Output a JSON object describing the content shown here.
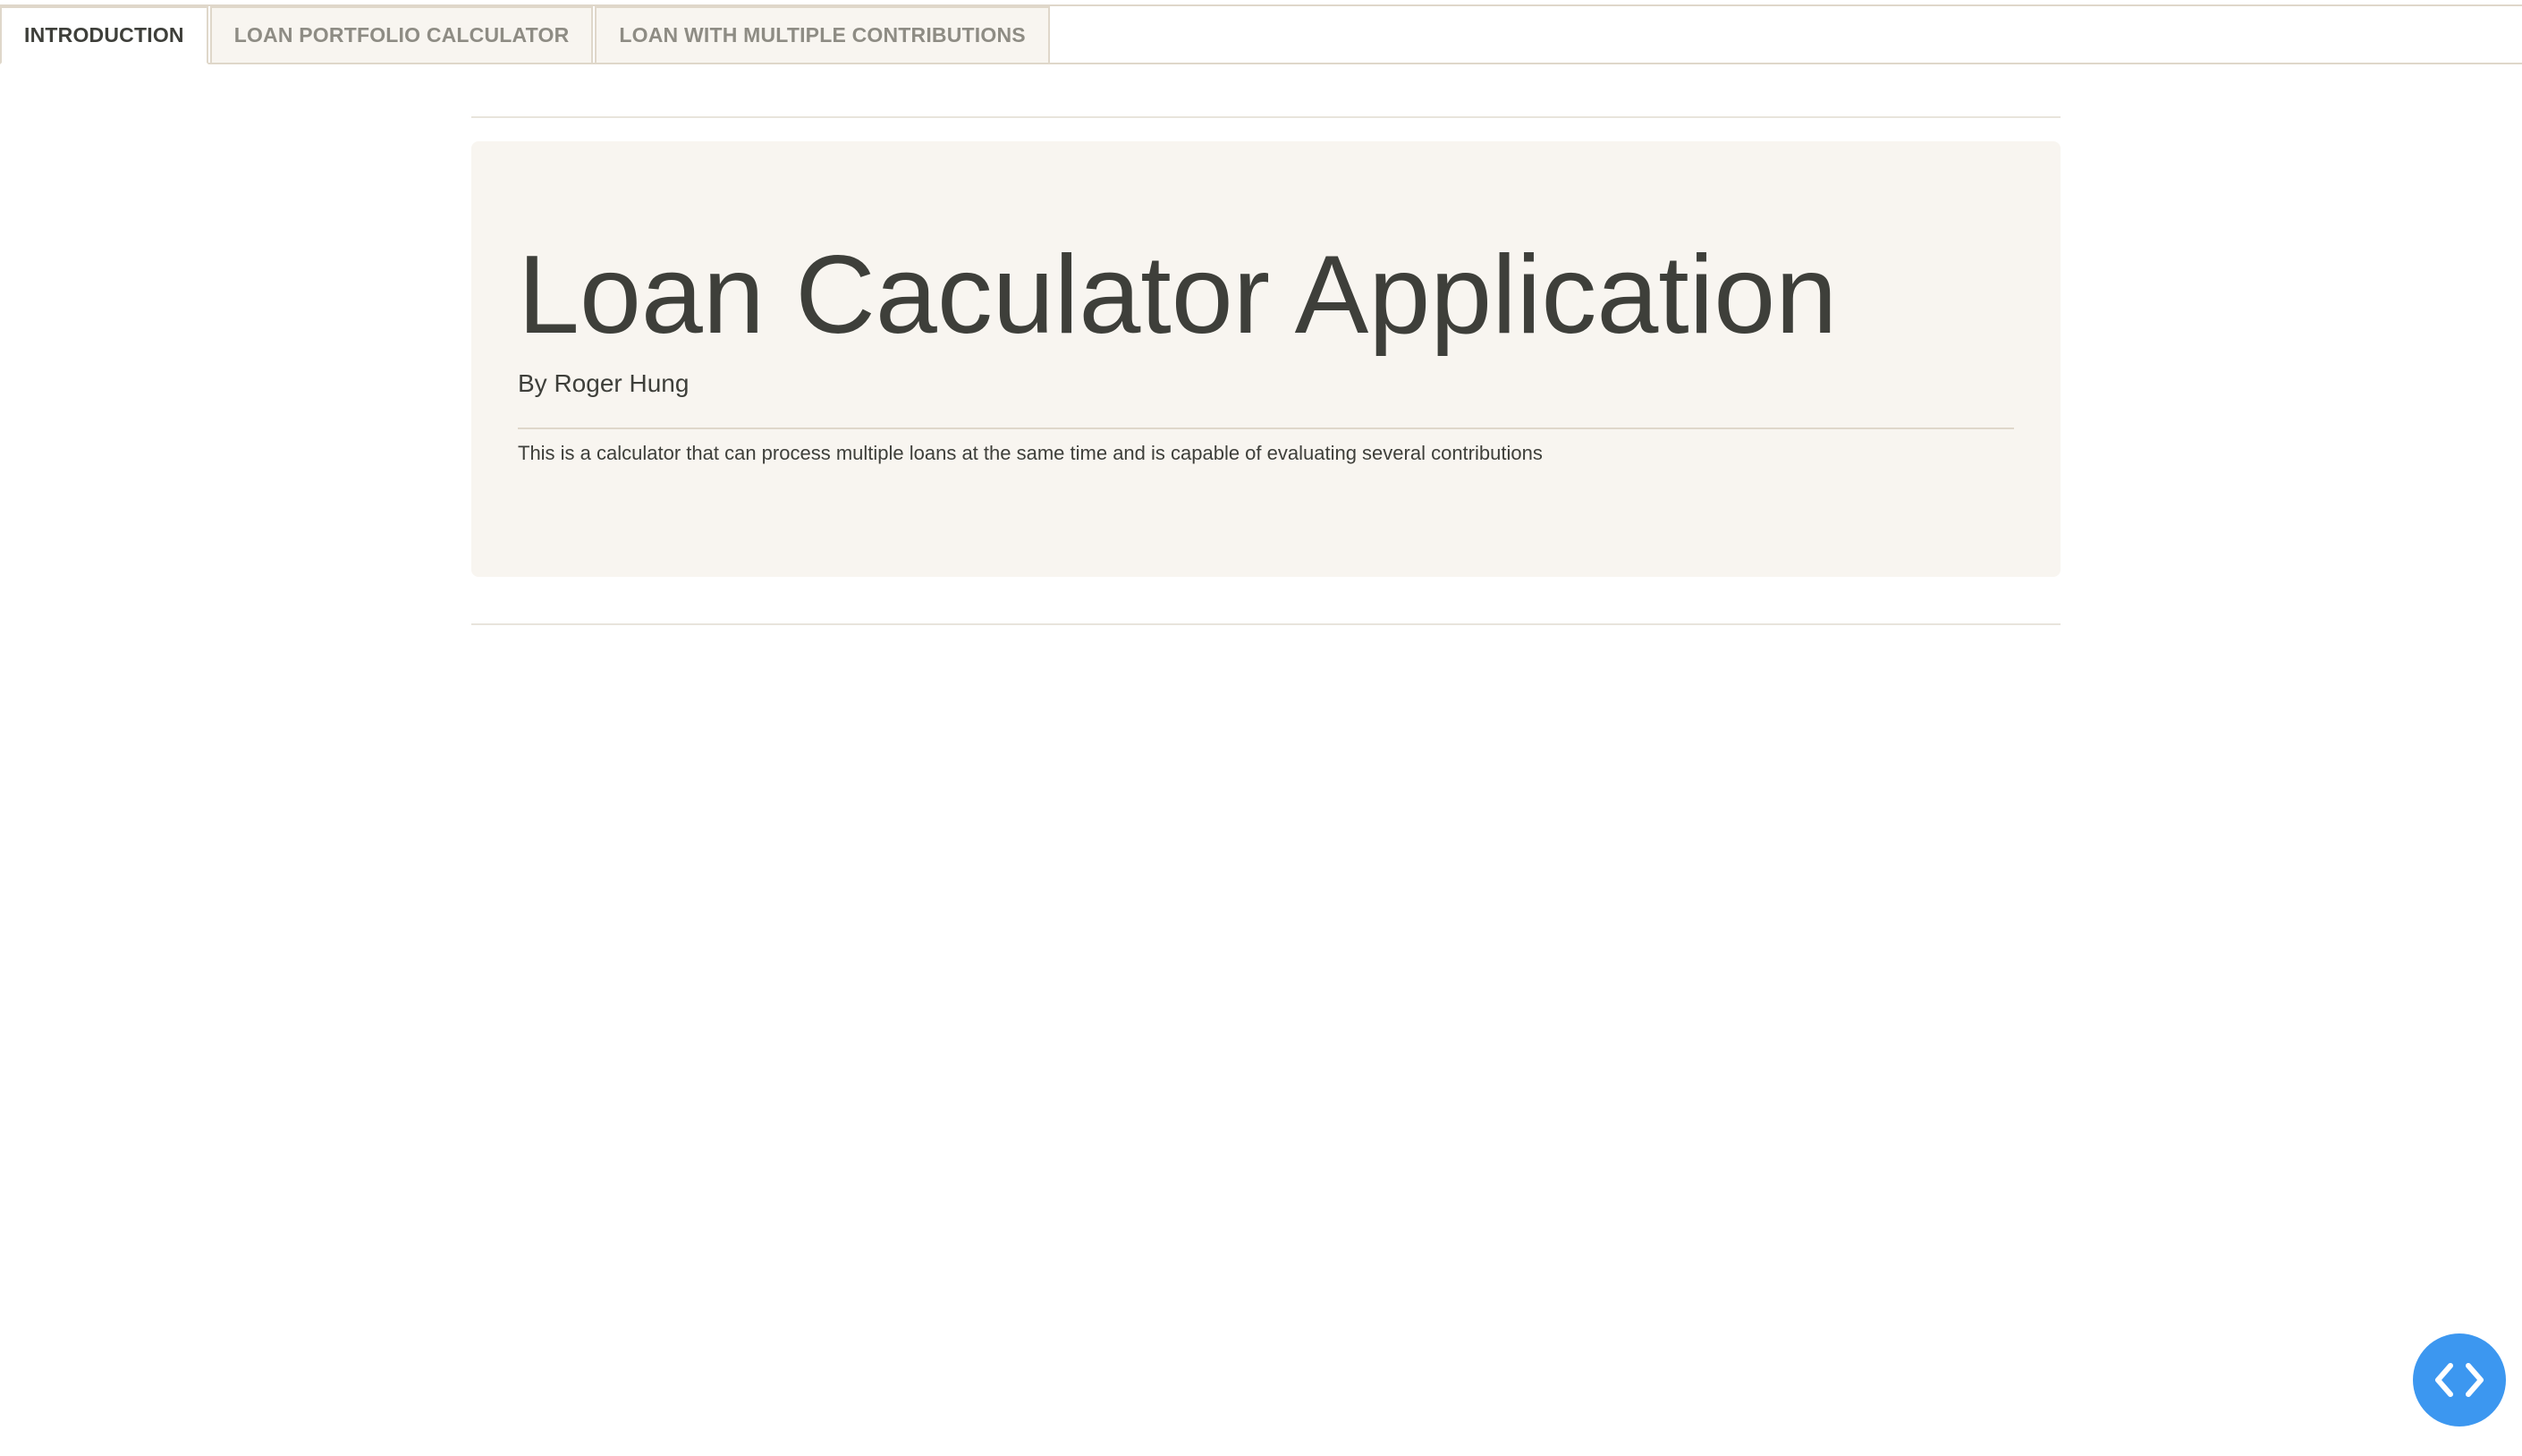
{
  "tabs": [
    {
      "label": "INTRODUCTION",
      "active": true
    },
    {
      "label": "LOAN PORTFOLIO CALCULATOR",
      "active": false
    },
    {
      "label": "LOAN WITH MULTIPLE CONTRIBUTIONS",
      "active": false
    }
  ],
  "jumbotron": {
    "title": "Loan Caculator Application",
    "byline": "By Roger Hung",
    "description": "This is a calculator that can process multiple loans at the same time and is capable of evaluating several contributions"
  },
  "fab": {
    "icon": "code-icon",
    "color": "#3c97f0"
  },
  "colors": {
    "text": "#3e3f3a",
    "tab_inactive_bg": "#f8f5f0",
    "tab_inactive_text": "#8e8c84",
    "jumbotron_bg": "#f8f5f0",
    "border": "#dfd7ca"
  }
}
